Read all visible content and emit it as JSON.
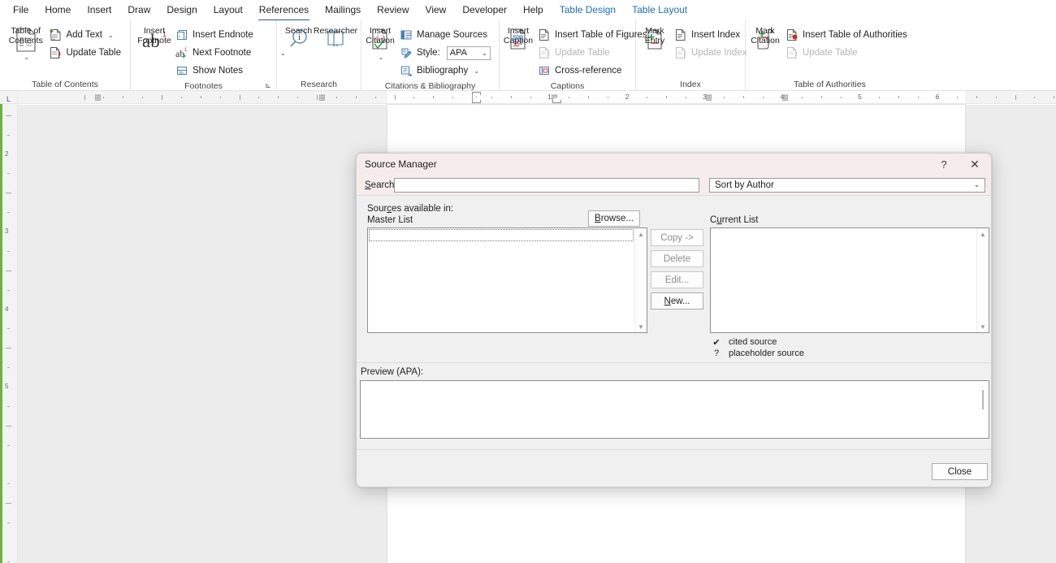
{
  "ribbon": {
    "tabs": [
      {
        "label": "File",
        "state": "normal"
      },
      {
        "label": "Home",
        "state": "normal"
      },
      {
        "label": "Insert",
        "state": "normal"
      },
      {
        "label": "Draw",
        "state": "normal"
      },
      {
        "label": "Design",
        "state": "normal"
      },
      {
        "label": "Layout",
        "state": "normal"
      },
      {
        "label": "References",
        "state": "active"
      },
      {
        "label": "Mailings",
        "state": "normal"
      },
      {
        "label": "Review",
        "state": "normal"
      },
      {
        "label": "View",
        "state": "normal"
      },
      {
        "label": "Developer",
        "state": "normal"
      },
      {
        "label": "Help",
        "state": "normal"
      },
      {
        "label": "Table Design",
        "state": "contextual"
      },
      {
        "label": "Table Layout",
        "state": "contextual"
      }
    ],
    "groups": {
      "toc": {
        "label": "Table of Contents",
        "big_button": "Table of\nContents",
        "items": [
          {
            "label": "Add Text",
            "has_caret": true,
            "disabled": false
          },
          {
            "label": "Update Table",
            "has_caret": false,
            "disabled": false
          }
        ]
      },
      "footnotes": {
        "label": "Footnotes",
        "big_button": "Insert\nFootnote",
        "big_glyph": "ab",
        "items": [
          {
            "label": "Insert Endnote",
            "has_caret": false,
            "disabled": false
          },
          {
            "label": "Next Footnote",
            "has_caret": true,
            "disabled": false
          },
          {
            "label": "Show Notes",
            "has_caret": false,
            "disabled": false
          }
        ],
        "launcher": true
      },
      "research": {
        "label": "Research",
        "buttons": [
          {
            "label": "Search"
          },
          {
            "label": "Researcher"
          }
        ]
      },
      "citations": {
        "label": "Citations & Bibliography",
        "big_button": "Insert\nCitation",
        "items": [
          {
            "label": "Manage Sources",
            "disabled": false
          },
          {
            "label": "Style:",
            "disabled": false
          },
          {
            "label": "Bibliography",
            "has_caret": true,
            "disabled": false
          }
        ],
        "style_value": "APA"
      },
      "captions": {
        "label": "Captions",
        "big_button": "Insert\nCaption",
        "items": [
          {
            "label": "Insert Table of Figures",
            "disabled": false
          },
          {
            "label": "Update Table",
            "disabled": true
          },
          {
            "label": "Cross-reference",
            "disabled": false
          }
        ]
      },
      "index": {
        "label": "Index",
        "big_button": "Mark\nEntry",
        "items": [
          {
            "label": "Insert Index",
            "disabled": false
          },
          {
            "label": "Update Index",
            "disabled": true
          }
        ]
      },
      "authorities": {
        "label": "Table of Authorities",
        "big_button": "Mark\nCitation",
        "items": [
          {
            "label": "Insert Table of Authorities",
            "disabled": false
          },
          {
            "label": "Update Table",
            "disabled": true
          }
        ]
      }
    }
  },
  "ruler": {
    "numbers": [
      "1",
      "2",
      "3",
      "4",
      "5",
      "6"
    ],
    "vertical_numbers": [
      "2",
      "3",
      "4",
      "5"
    ]
  },
  "dialog": {
    "title": "Source Manager",
    "help_glyph": "?",
    "close_glyph": "✕",
    "search_label": "Search:",
    "search_value": "",
    "sort_value": "Sort by Author",
    "sources_available_label": "Sources available in:",
    "master_list_label": "Master List",
    "current_list_label": "Current List",
    "browse_label": "Browse...",
    "buttons": [
      {
        "label": "Copy ->",
        "enabled": false
      },
      {
        "label": "Delete",
        "enabled": false
      },
      {
        "label": "Edit...",
        "enabled": false
      },
      {
        "label": "New...",
        "enabled": true
      }
    ],
    "legend": [
      {
        "glyph": "✔",
        "text": "cited source"
      },
      {
        "glyph": "?",
        "text": "placeholder source"
      }
    ],
    "preview_label": "Preview (APA):",
    "preview_text": "",
    "close_button": "Close",
    "master_list_items": [],
    "current_list_items": []
  },
  "colors": {
    "accent": "#2b579a",
    "contextual_tab": "#1a6ebd",
    "dialog_title_bg": "#f7ecec",
    "dialog_bg": "#f0f0f0",
    "canvas_bg": "#ececec",
    "left_strip": "#6db33f"
  }
}
